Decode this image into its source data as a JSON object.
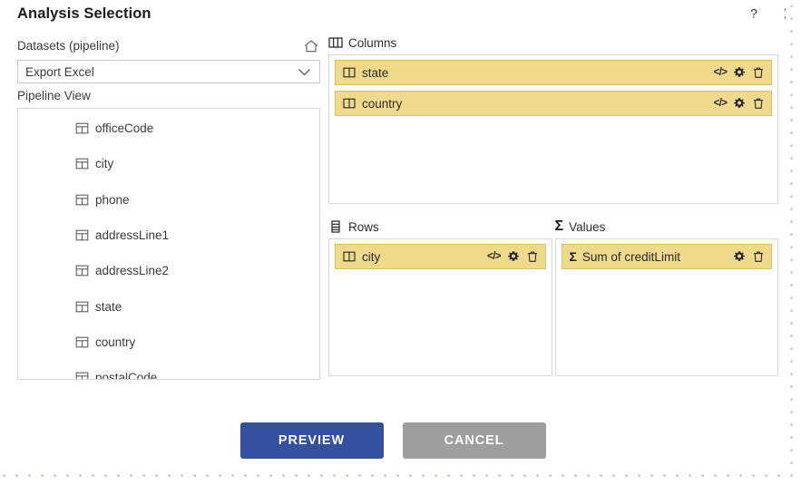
{
  "dialog": {
    "title": "Analysis Selection",
    "help_icon": "question-mark-icon",
    "close_icon": "close-icon"
  },
  "left": {
    "datasets_label": "Datasets (pipeline)",
    "home_icon": "home-icon",
    "dataset_select": {
      "value": "Export Excel",
      "chevron_icon": "chevron-down-icon"
    },
    "pipeline_label": "Pipeline View",
    "pipeline_items": [
      {
        "label": "officeCode",
        "icon": "table-field-icon"
      },
      {
        "label": "city",
        "icon": "table-field-icon"
      },
      {
        "label": "phone",
        "icon": "table-field-icon"
      },
      {
        "label": "addressLine1",
        "icon": "table-field-icon"
      },
      {
        "label": "addressLine2",
        "icon": "table-field-icon"
      },
      {
        "label": "state",
        "icon": "table-field-icon"
      },
      {
        "label": "country",
        "icon": "table-field-icon"
      },
      {
        "label": "postalCode",
        "icon": "table-field-icon"
      }
    ]
  },
  "zones": {
    "columns": {
      "title": "Columns",
      "icon": "view-column-icon",
      "chips": [
        {
          "label": "state",
          "icon": "column-icon",
          "code_icon": "code-icon",
          "settings_icon": "gear-icon",
          "delete_icon": "trash-icon"
        },
        {
          "label": "country",
          "icon": "column-icon",
          "code_icon": "code-icon",
          "settings_icon": "gear-icon",
          "delete_icon": "trash-icon"
        }
      ]
    },
    "rows": {
      "title": "Rows",
      "icon": "view-row-icon",
      "chips": [
        {
          "label": "city",
          "icon": "column-icon",
          "code_icon": "code-icon",
          "settings_icon": "gear-icon",
          "delete_icon": "trash-icon"
        }
      ]
    },
    "values": {
      "title": "Values",
      "icon": "sigma-icon",
      "sigma_glyph": "Σ",
      "chips": [
        {
          "label": "Sum of creditLimit",
          "icon": "sigma-icon",
          "settings_icon": "gear-icon",
          "delete_icon": "trash-icon"
        }
      ]
    }
  },
  "footer": {
    "preview_label": "PREVIEW",
    "cancel_label": "CANCEL"
  },
  "colors": {
    "primary_button": "#34509f",
    "secondary_button": "#9e9e9e",
    "chip_fill": "#efd98c",
    "chip_border": "#dbc06b",
    "background_dots": "#c3caee"
  }
}
